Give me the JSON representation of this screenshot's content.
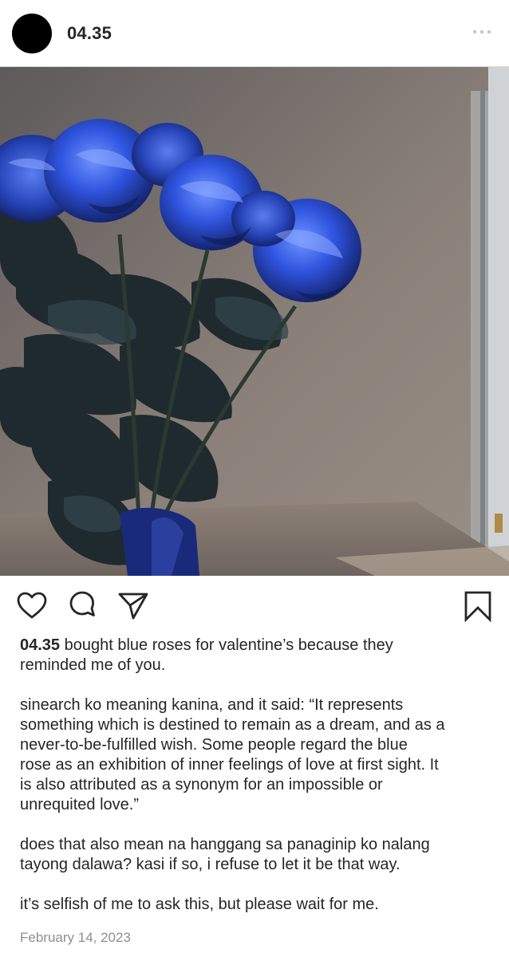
{
  "post": {
    "username": "04.35",
    "date": "February 14, 2023"
  },
  "caption": {
    "first_line": "bought blue roses for valentine’s because they\nreminded me of you.",
    "paragraphs": [
      "sinearch ko meaning kanina, and it said: “It represents\nsomething which is destined to remain as a dream, and as a\nnever-to-be-fulfilled wish. Some people regard the blue\nrose as an exhibition of inner feelings of love at first sight. It\nis also attributed as a synonym for an impossible or\nunrequited love.”",
      "does that also mean na hanggang sa panaginip ko nalang\ntayong dalawa? kasi if so, i refuse to let it be that way.",
      "it’s selfish of me to ask this, but please wait for me."
    ]
  },
  "icons": {
    "more": "more-options-icon",
    "like": "heart-icon",
    "comment": "comment-icon",
    "share": "paper-plane-icon",
    "save": "bookmark-icon"
  },
  "colors": {
    "text": "#262626",
    "muted": "#8e8e8e",
    "rose_blue": "#2a4fd6",
    "wall": "#7d7670"
  }
}
